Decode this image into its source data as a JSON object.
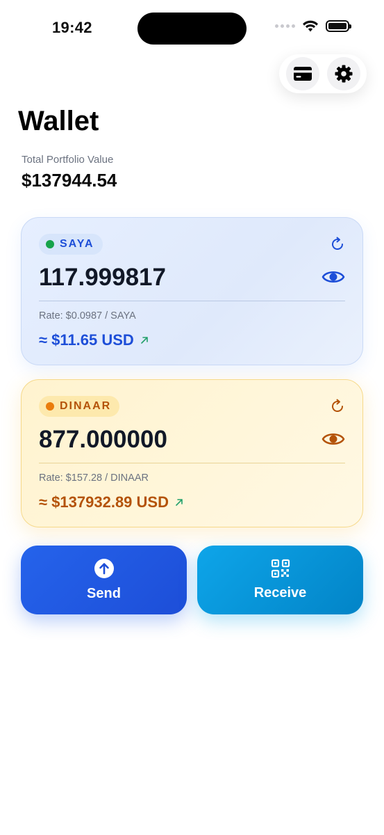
{
  "status_bar": {
    "time": "19:42"
  },
  "header": {
    "title": "Wallet",
    "actions": [
      {
        "icon": "card-icon"
      },
      {
        "icon": "gear-icon"
      }
    ]
  },
  "portfolio": {
    "label": "Total Portfolio Value",
    "value": "$137944.54"
  },
  "tokens": [
    {
      "symbol": "SAYA",
      "balance": "117.999817",
      "rate": "Rate: $0.0987 / SAYA",
      "usd_value": "≈ $11.65 USD",
      "dot_color": "#16a34a",
      "accent_color": "#1d4ed8"
    },
    {
      "symbol": "DINAAR",
      "balance": "877.000000",
      "rate": "Rate: $157.28 / DINAAR",
      "usd_value": "≈ $137932.89 USD",
      "dot_color": "#ea7d0c",
      "accent_color": "#b45309"
    }
  ],
  "actions": {
    "send_label": "Send",
    "receive_label": "Receive"
  },
  "colors": {
    "send": "#2563eb",
    "receive": "#0ea5e9",
    "trend_up": "#22a06b"
  }
}
